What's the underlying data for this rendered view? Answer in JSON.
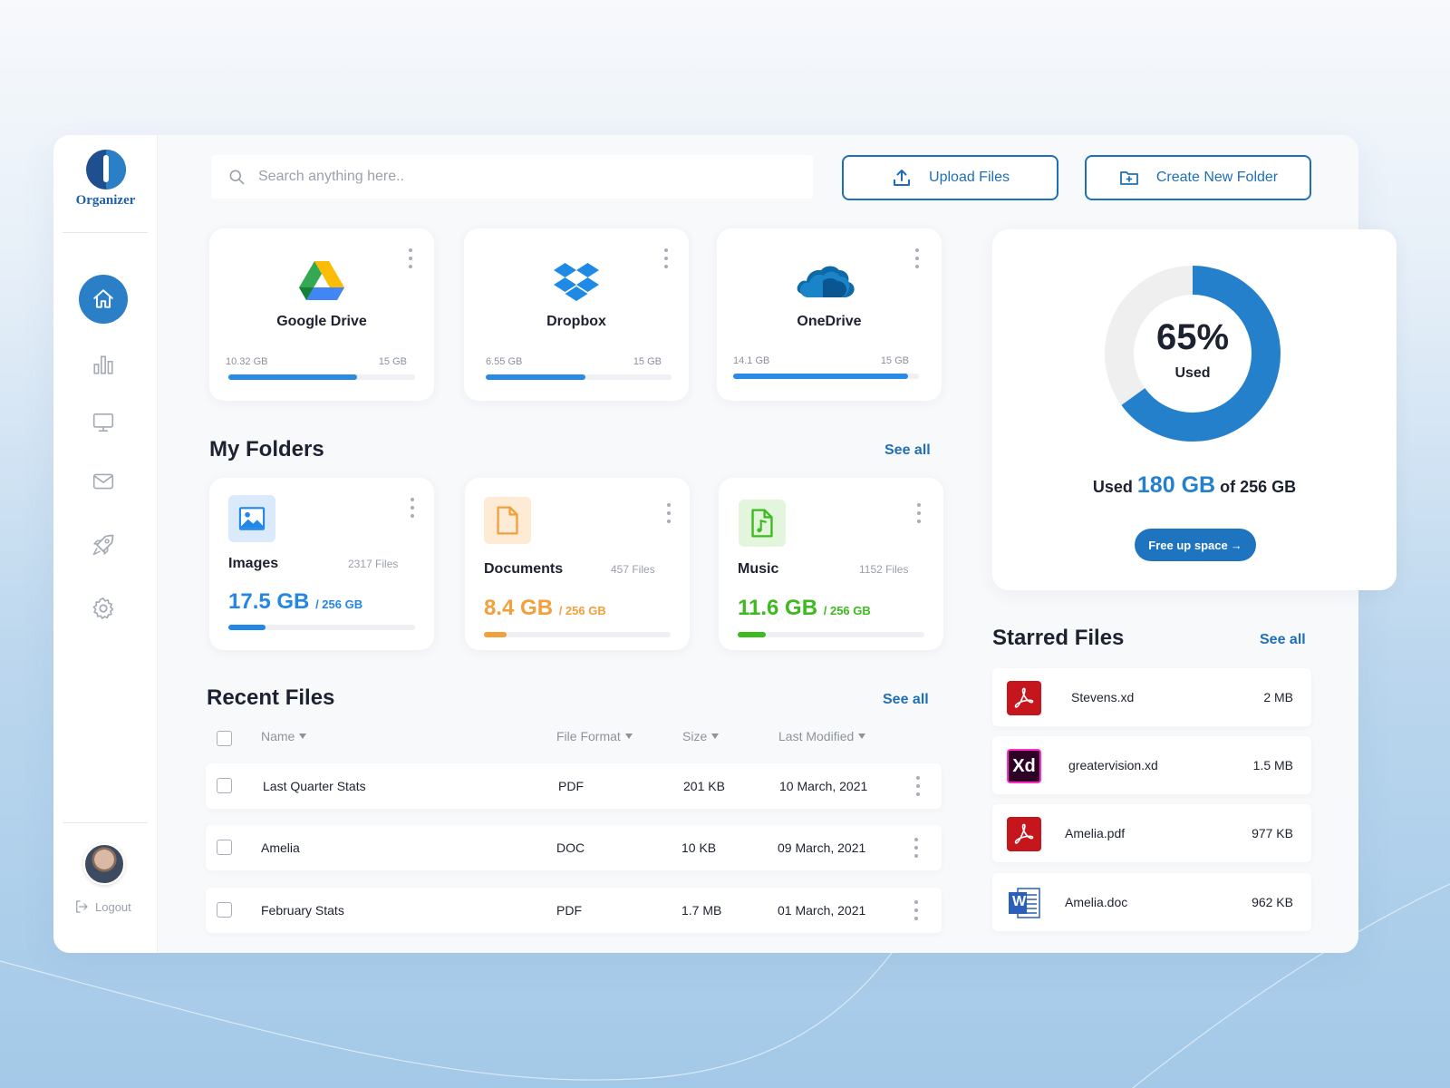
{
  "app": {
    "name": "Organizer"
  },
  "colors": {
    "accent": "#1f6fb8",
    "images": "#2287e6",
    "documents": "#f2a03b",
    "music": "#3cba1e",
    "pdf": "#c4161c",
    "xd": "#ff2bc2",
    "word": "#2b5fb8"
  },
  "sidebar": {
    "items": [
      {
        "icon": "home-icon",
        "active": true
      },
      {
        "icon": "bar-chart-icon",
        "active": false
      },
      {
        "icon": "monitor-icon",
        "active": false
      },
      {
        "icon": "mail-icon",
        "active": false
      },
      {
        "icon": "rocket-icon",
        "active": false
      },
      {
        "icon": "gear-icon",
        "active": false
      }
    ],
    "logout_label": "Logout"
  },
  "search": {
    "placeholder": "Search anything here.."
  },
  "actions": {
    "upload_label": "Upload Files",
    "create_folder_label": "Create New Folder"
  },
  "drives": [
    {
      "name": "Google Drive",
      "used": "10.32 GB",
      "total": "15 GB",
      "fraction": 0.688
    },
    {
      "name": "Dropbox",
      "used": "6.55 GB",
      "total": "15 GB",
      "fraction": 0.537
    },
    {
      "name": "OneDrive",
      "used": "14.1 GB",
      "total": "15 GB",
      "fraction": 0.94
    }
  ],
  "folders": {
    "title": "My Folders",
    "see_all": "See all",
    "items": [
      {
        "name": "Images",
        "count": "2317 Files",
        "size": "17.5 GB",
        "of": "/ 256 GB",
        "fraction": 0.2
      },
      {
        "name": "Documents",
        "count": "457 Files",
        "size": "8.4 GB",
        "of": "/ 256 GB",
        "fraction": 0.12
      },
      {
        "name": "Music",
        "count": "1152 Files",
        "size": "11.6 GB",
        "of": "/ 256 GB",
        "fraction": 0.15
      }
    ]
  },
  "recent": {
    "title": "Recent Files",
    "see_all": "See all",
    "columns": [
      "Name",
      "File Format",
      "Size",
      "Last Modified"
    ],
    "rows": [
      {
        "name": "Last Quarter Stats",
        "format": "PDF",
        "size": "201 KB",
        "modified": "10 March, 2021"
      },
      {
        "name": "Amelia",
        "format": "DOC",
        "size": "10 KB",
        "modified": "09 March, 2021"
      },
      {
        "name": "February Stats",
        "format": "PDF",
        "size": "1.7 MB",
        "modified": "01 March, 2021"
      }
    ]
  },
  "storage": {
    "percent_label": "65%",
    "percent_value": 0.65,
    "used_word": "Used",
    "summary_prefix": "Used",
    "summary_used": "180 GB",
    "summary_suffix": "of 256 GB",
    "free_button": "Free up space",
    "free_button_arrow": "→"
  },
  "starred": {
    "title": "Starred Files",
    "see_all": "See all",
    "items": [
      {
        "name": "Stevens.xd",
        "size": "2 MB",
        "icon": "pdf-icon"
      },
      {
        "name": "greatervision.xd",
        "size": "1.5 MB",
        "icon": "xd-icon",
        "icon_text": "Xd"
      },
      {
        "name": "Amelia.pdf",
        "size": "977 KB",
        "icon": "pdf-icon"
      },
      {
        "name": "Amelia.doc",
        "size": "962 KB",
        "icon": "word-icon",
        "icon_text": "W"
      }
    ]
  }
}
